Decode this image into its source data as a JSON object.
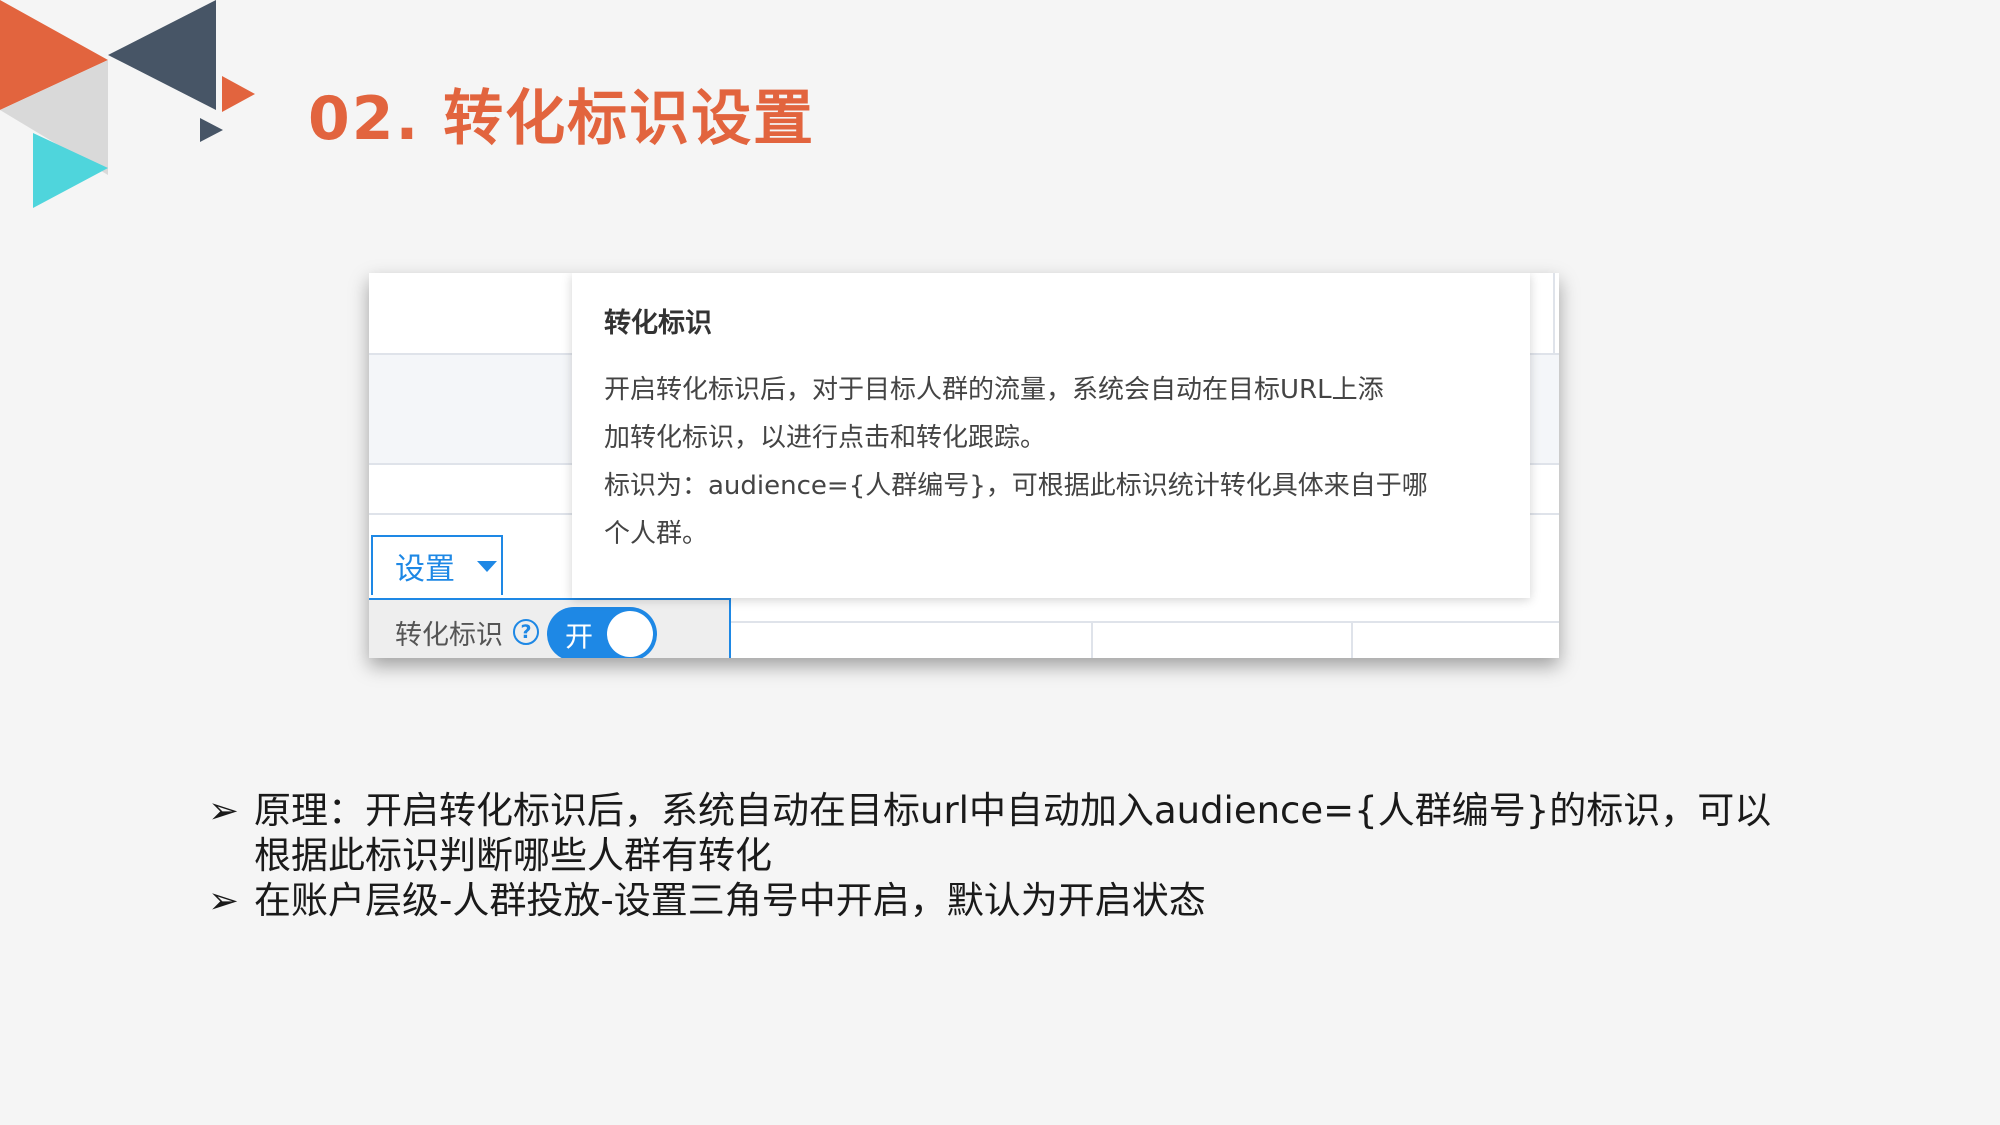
{
  "slide": {
    "title": "02. 转化标识设置",
    "colors": {
      "accent": "#e2643e",
      "dark": "#475566",
      "cyan": "#4fd5dc",
      "gray": "#d9d9d9"
    }
  },
  "screenshot": {
    "settings_label": "设置",
    "conversion_label": "转化标识",
    "help_icon": "question-circle-icon",
    "toggle_label": "开",
    "toggle_state": "on",
    "tooltip": {
      "title": "转化标识",
      "line1": "开启转化标识后，对于目标人群的流量，系统会自动在目标URL上添",
      "line2": "加转化标识，以进行点击和转化跟踪。",
      "line3": "标识为：audience={人群编号}，可根据此标识统计转化具体来自于哪",
      "line4": "个人群。"
    },
    "brand_color": "#1e88e5"
  },
  "bullets": [
    {
      "marker": "➢",
      "text": "原理：开启转化标识后，系统自动在目标url中自动加入audience={人群编号}的标识，可以根据此标识判断哪些人群有转化"
    },
    {
      "marker": "➢",
      "text": "在账户层级-人群投放-设置三角号中开启，默认为开启状态"
    }
  ]
}
